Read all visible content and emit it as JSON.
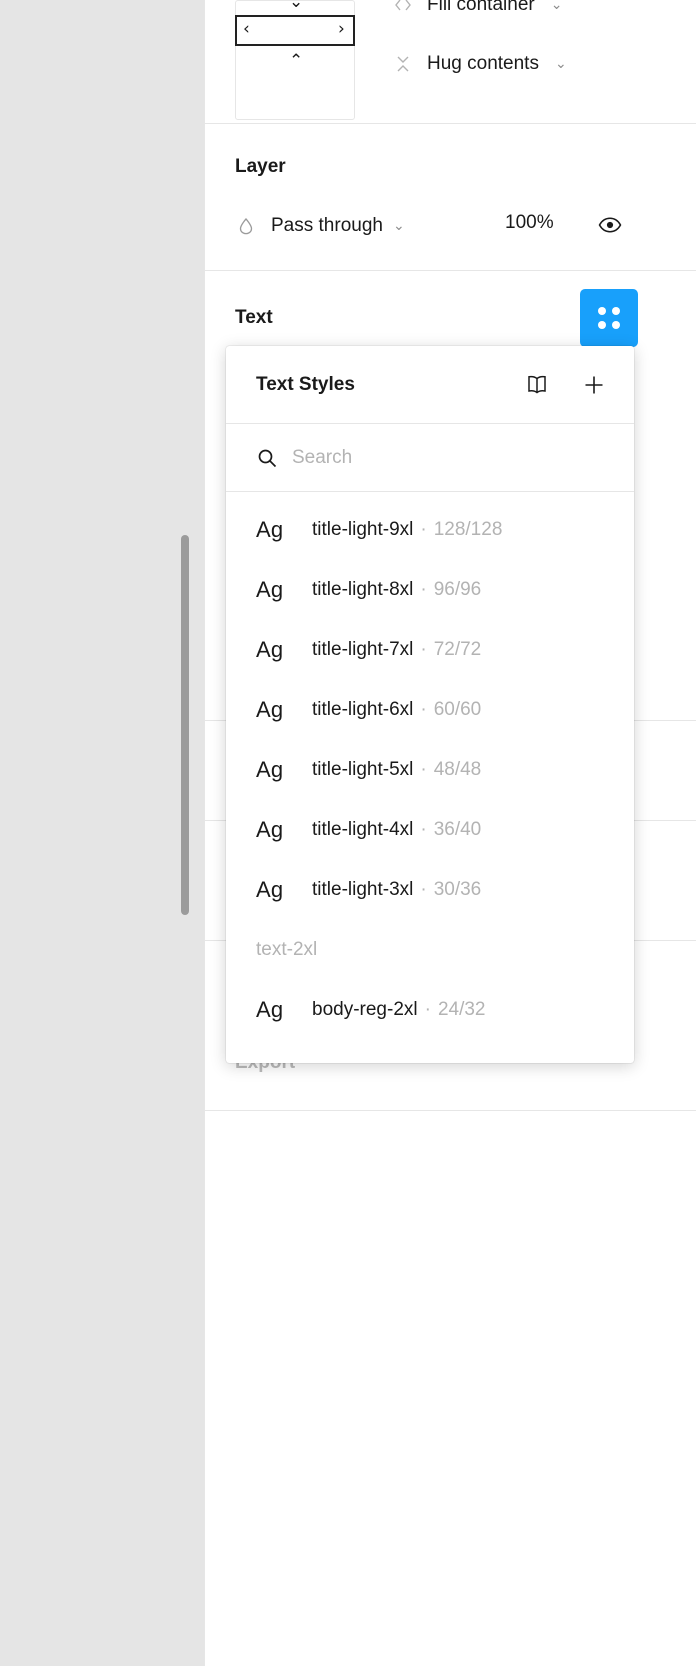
{
  "panel": {
    "layout": {
      "alignment_pad": {
        "name": "alignment-pad",
        "arrow_down": "⌄",
        "arrow_up": "⌃",
        "arrow_left": "‹",
        "arrow_right": "›"
      },
      "horizontal_resizing": {
        "icon": "fill-container-icon",
        "label": "Fill container",
        "caret": "⌄"
      },
      "vertical_resizing": {
        "icon": "hug-contents-icon",
        "label": "Hug contents",
        "caret": "⌄"
      }
    },
    "layer": {
      "title": "Layer",
      "blend_mode": {
        "icon": "blend-mode-icon",
        "label": "Pass through",
        "caret": "⌄"
      },
      "opacity": "100%",
      "visibility_icon": "eye-icon"
    },
    "text": {
      "title": "Text",
      "styles_button_icon": "four-dot-grid-icon",
      "styles_button_color": "#18a0fb"
    },
    "export": {
      "title": "Export"
    }
  },
  "popup": {
    "title": "Text Styles",
    "library_icon": "book-icon",
    "add_icon": "plus-icon",
    "search": {
      "icon": "search-icon",
      "value": "",
      "placeholder": "Search"
    },
    "preview_glyph": "Ag",
    "separator": "·",
    "items": [
      {
        "type": "style",
        "preview": "Ag",
        "name": "title-light-9xl",
        "meta": "128/128"
      },
      {
        "type": "style",
        "preview": "Ag",
        "name": "title-light-8xl",
        "meta": "96/96"
      },
      {
        "type": "style",
        "preview": "Ag",
        "name": "title-light-7xl",
        "meta": "72/72"
      },
      {
        "type": "style",
        "preview": "Ag",
        "name": "title-light-6xl",
        "meta": "60/60"
      },
      {
        "type": "style",
        "preview": "Ag",
        "name": "title-light-5xl",
        "meta": "48/48"
      },
      {
        "type": "style",
        "preview": "Ag",
        "name": "title-light-4xl",
        "meta": "36/40"
      },
      {
        "type": "style",
        "preview": "Ag",
        "name": "title-light-3xl",
        "meta": "30/36"
      },
      {
        "type": "group",
        "name": "text-2xl"
      },
      {
        "type": "style",
        "preview": "Ag",
        "name": "body-reg-2xl",
        "meta": "24/32"
      }
    ]
  },
  "scrollbar": {
    "name": "panel-scrollbar"
  }
}
